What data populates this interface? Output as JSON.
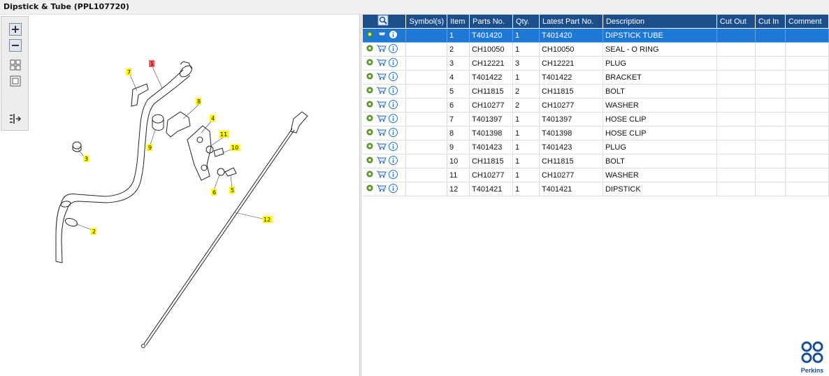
{
  "window": {
    "title": "Dipstick & Tube (PPL107720)"
  },
  "toolbar": {
    "items": [
      {
        "name": "zoom-in-icon"
      },
      {
        "name": "zoom-out-icon"
      },
      {
        "name": "fit-grid-icon"
      },
      {
        "name": "fit-window-icon"
      },
      {
        "name": "export-list-icon"
      }
    ]
  },
  "diagram": {
    "callouts": [
      "1",
      "2",
      "3",
      "4",
      "5",
      "6",
      "7",
      "8",
      "9",
      "10",
      "11",
      "12"
    ],
    "highlighted_callout": "1"
  },
  "table": {
    "headers": [
      "Symbol(s)",
      "Item",
      "Parts No.",
      "Qty.",
      "Latest Part No.",
      "Description",
      "Cut Out",
      "Cut In",
      "Comment"
    ],
    "selected_row": 0,
    "rows": [
      {
        "item": "1",
        "part_no": "T401420",
        "qty": "1",
        "latest_part_no": "T401420",
        "description": "DIPSTICK TUBE",
        "cut_out": "",
        "cut_in": "",
        "comment": ""
      },
      {
        "item": "2",
        "part_no": "CH10050",
        "qty": "1",
        "latest_part_no": "CH10050",
        "description": "SEAL - O RING",
        "cut_out": "",
        "cut_in": "",
        "comment": ""
      },
      {
        "item": "3",
        "part_no": "CH12221",
        "qty": "3",
        "latest_part_no": "CH12221",
        "description": "PLUG",
        "cut_out": "",
        "cut_in": "",
        "comment": ""
      },
      {
        "item": "4",
        "part_no": "T401422",
        "qty": "1",
        "latest_part_no": "T401422",
        "description": "BRACKET",
        "cut_out": "",
        "cut_in": "",
        "comment": ""
      },
      {
        "item": "5",
        "part_no": "CH11815",
        "qty": "2",
        "latest_part_no": "CH11815",
        "description": "BOLT",
        "cut_out": "",
        "cut_in": "",
        "comment": ""
      },
      {
        "item": "6",
        "part_no": "CH10277",
        "qty": "2",
        "latest_part_no": "CH10277",
        "description": "WASHER",
        "cut_out": "",
        "cut_in": "",
        "comment": ""
      },
      {
        "item": "7",
        "part_no": "T401397",
        "qty": "1",
        "latest_part_no": "T401397",
        "description": "HOSE CLIP",
        "cut_out": "",
        "cut_in": "",
        "comment": ""
      },
      {
        "item": "8",
        "part_no": "T401398",
        "qty": "1",
        "latest_part_no": "T401398",
        "description": "HOSE CLIP",
        "cut_out": "",
        "cut_in": "",
        "comment": ""
      },
      {
        "item": "9",
        "part_no": "T401423",
        "qty": "1",
        "latest_part_no": "T401423",
        "description": "PLUG",
        "cut_out": "",
        "cut_in": "",
        "comment": ""
      },
      {
        "item": "10",
        "part_no": "CH11815",
        "qty": "1",
        "latest_part_no": "CH11815",
        "description": "BOLT",
        "cut_out": "",
        "cut_in": "",
        "comment": ""
      },
      {
        "item": "11",
        "part_no": "CH10277",
        "qty": "1",
        "latest_part_no": "CH10277",
        "description": "WASHER",
        "cut_out": "",
        "cut_in": "",
        "comment": ""
      },
      {
        "item": "12",
        "part_no": "T401421",
        "qty": "1",
        "latest_part_no": "T401421",
        "description": "DIPSTICK",
        "cut_out": "",
        "cut_in": "",
        "comment": ""
      }
    ]
  },
  "logo": {
    "text": "Perkins",
    "color": "#1b4f95"
  },
  "colors": {
    "header": "#1c4e8a",
    "selected_row": "#1e78d6",
    "callout_yellow": "#ffff00",
    "callout_red": "#ff5a5a"
  }
}
